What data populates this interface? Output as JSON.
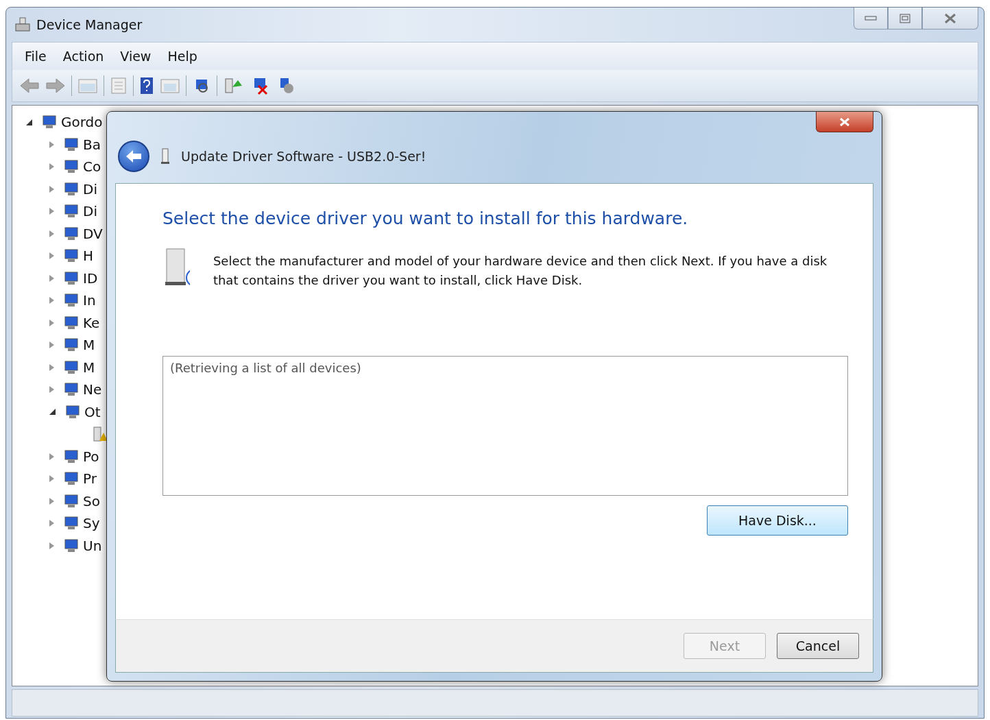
{
  "window": {
    "title": "Device Manager"
  },
  "menu": [
    "File",
    "Action",
    "View",
    "Help"
  ],
  "tree": {
    "label": "Gordo",
    "expanded": true,
    "children": [
      {
        "label": "Ba",
        "expanded": false
      },
      {
        "label": "Co",
        "expanded": false
      },
      {
        "label": "Di",
        "expanded": false
      },
      {
        "label": "Di",
        "expanded": false
      },
      {
        "label": "DV",
        "expanded": false
      },
      {
        "label": "H",
        "expanded": false
      },
      {
        "label": "ID",
        "expanded": false
      },
      {
        "label": "In",
        "expanded": false
      },
      {
        "label": "Ke",
        "expanded": false
      },
      {
        "label": "M",
        "expanded": false
      },
      {
        "label": "M",
        "expanded": false
      },
      {
        "label": "Ne",
        "expanded": false
      },
      {
        "label": "Ot",
        "expanded": true,
        "children": [
          {
            "kind": "unknown-device"
          }
        ]
      },
      {
        "label": "Po",
        "expanded": false
      },
      {
        "label": "Pr",
        "expanded": false
      },
      {
        "label": "So",
        "expanded": false
      },
      {
        "label": "Sy",
        "expanded": false
      },
      {
        "label": "Un",
        "expanded": false
      }
    ]
  },
  "dialog": {
    "title": "Update Driver Software - USB2.0-Ser!",
    "heading": "Select the device driver you want to install for this hardware.",
    "instructions": "Select the manufacturer and model of your hardware device and then click Next. If you have a disk that contains the driver you want to install, click Have Disk.",
    "list_message": "(Retrieving a list of all devices)",
    "have_disk_button": "Have Disk...",
    "buttons": [
      {
        "label": "Next",
        "disabled": true
      },
      {
        "label": "Cancel",
        "disabled": false
      }
    ]
  }
}
